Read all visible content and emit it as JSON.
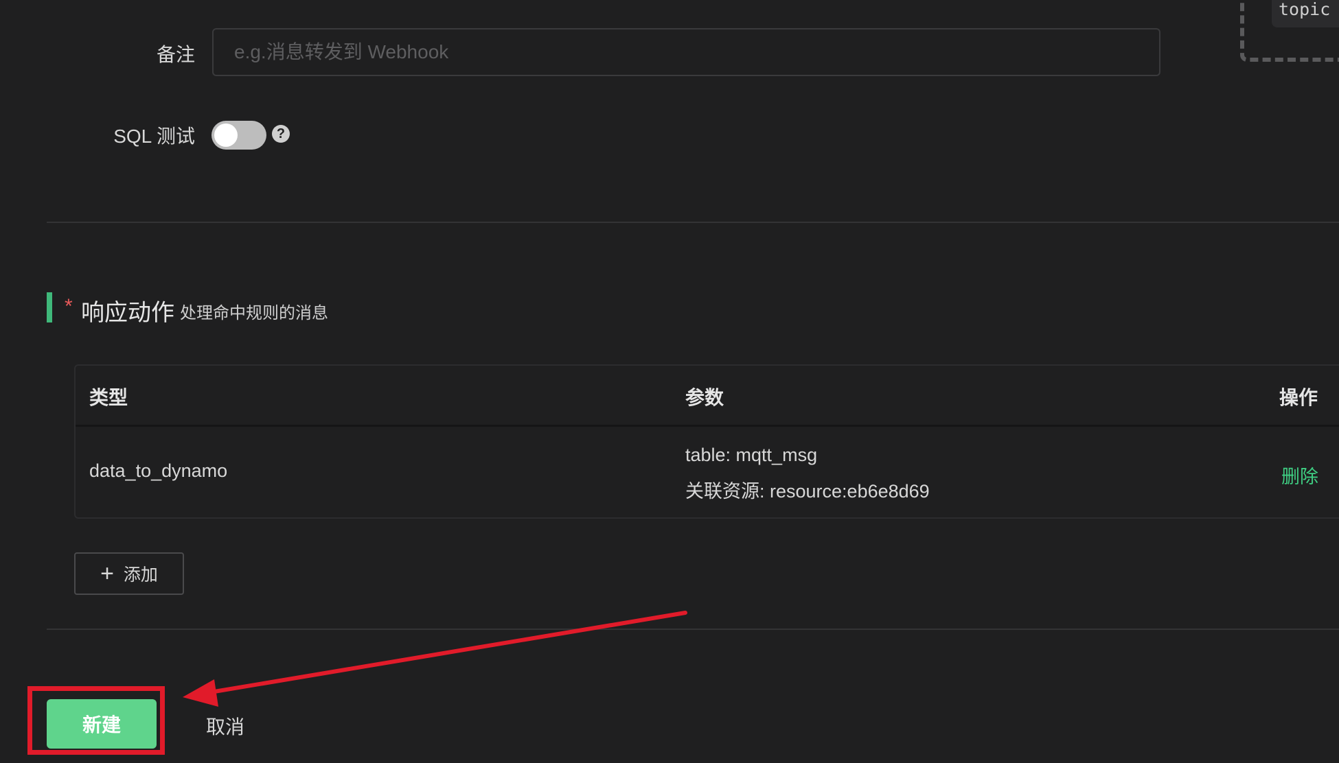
{
  "topic_tag": "topic",
  "form": {
    "remark_label": "备注",
    "remark_placeholder": "e.g.消息转发到 Webhook",
    "sql_test_label": "SQL 测试",
    "help_glyph": "?"
  },
  "actions": {
    "required_mark": "*",
    "title": "响应动作",
    "subtitle": "处理命中规则的消息",
    "table": {
      "headers": [
        "类型",
        "参数",
        "操作"
      ],
      "rows": [
        {
          "type": "data_to_dynamo",
          "params": [
            "table: mqtt_msg",
            "关联资源: resource:eb6e8d69"
          ],
          "operation": "删除"
        }
      ]
    },
    "add_label": "添加",
    "add_icon": "+"
  },
  "footer": {
    "create_label": "新建",
    "cancel_label": "取消"
  },
  "colors": {
    "accent": "#5fd48c",
    "delete_link": "#3fcf83",
    "annotation_red": "#e11b2a",
    "background": "#1f1f20"
  }
}
